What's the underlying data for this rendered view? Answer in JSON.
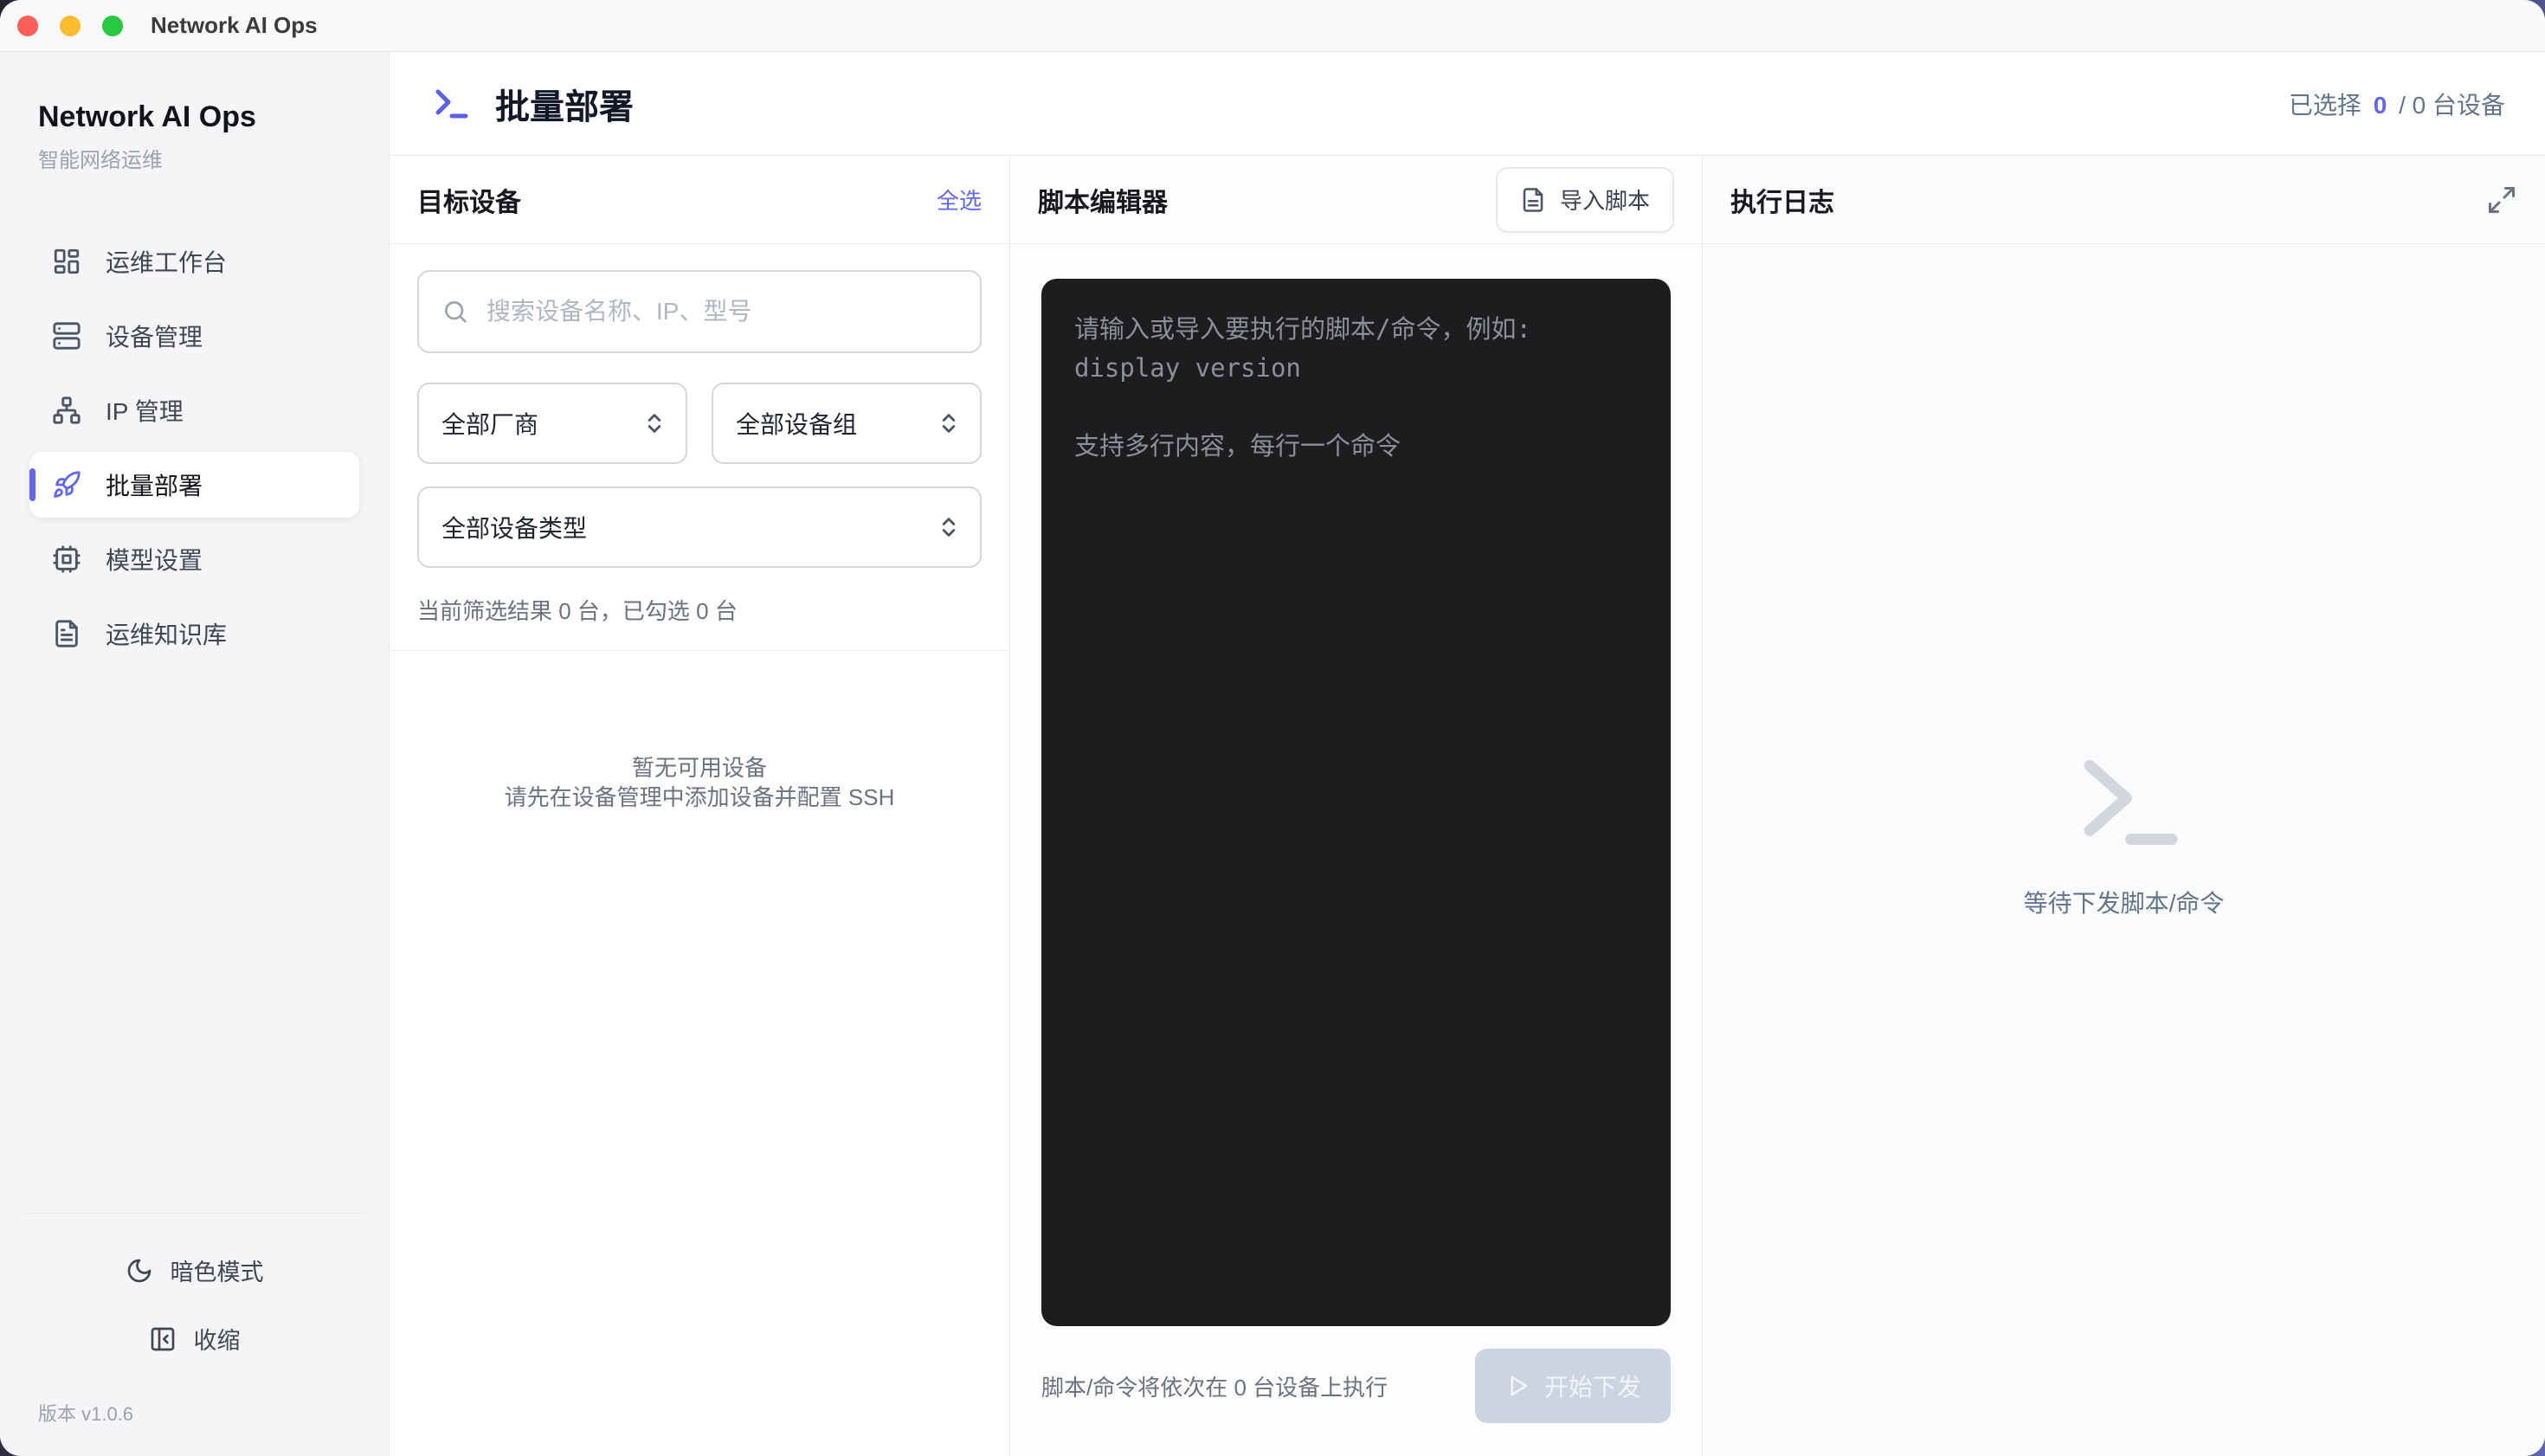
{
  "titlebar": {
    "title": "Network AI Ops"
  },
  "sidebar": {
    "brand": "Network AI Ops",
    "subtitle": "智能网络运维",
    "items": [
      {
        "label": "运维工作台",
        "icon": "dashboard-icon",
        "active": false
      },
      {
        "label": "设备管理",
        "icon": "server-icon",
        "active": false
      },
      {
        "label": "IP 管理",
        "icon": "network-icon",
        "active": false
      },
      {
        "label": "批量部署",
        "icon": "rocket-icon",
        "active": true
      },
      {
        "label": "模型设置",
        "icon": "cpu-icon",
        "active": false
      },
      {
        "label": "运维知识库",
        "icon": "file-text-icon",
        "active": false
      }
    ],
    "dark_mode_label": "暗色模式",
    "collapse_label": "收缩",
    "version": "版本 v1.0.6"
  },
  "header": {
    "title": "批量部署",
    "selected_label": "已选择",
    "selected_count": "0",
    "selected_total": "/ 0 台设备"
  },
  "devices": {
    "title": "目标设备",
    "select_all": "全选",
    "search_placeholder": "搜索设备名称、IP、型号",
    "vendor_filter": "全部厂商",
    "group_filter": "全部设备组",
    "type_filter": "全部设备类型",
    "filter_summary": "当前筛选结果 0 台，已勾选 0 台",
    "empty_line1": "暂无可用设备",
    "empty_line2": "请先在设备管理中添加设备并配置 SSH"
  },
  "script": {
    "title": "脚本编辑器",
    "import_label": "导入脚本",
    "editor_placeholder": "请输入或导入要执行的脚本/命令，例如: display version\n\n支持多行内容，每行一个命令",
    "footer_note": "脚本/命令将依次在 0 台设备上执行",
    "run_label": "开始下发"
  },
  "log": {
    "title": "执行日志",
    "empty_text": "等待下发脚本/命令"
  },
  "colors": {
    "accent": "#6366f1",
    "editor_bg": "#1d1d1f",
    "traffic_red": "#ff5f57",
    "traffic_yellow": "#febc2e",
    "traffic_green": "#28c840"
  }
}
